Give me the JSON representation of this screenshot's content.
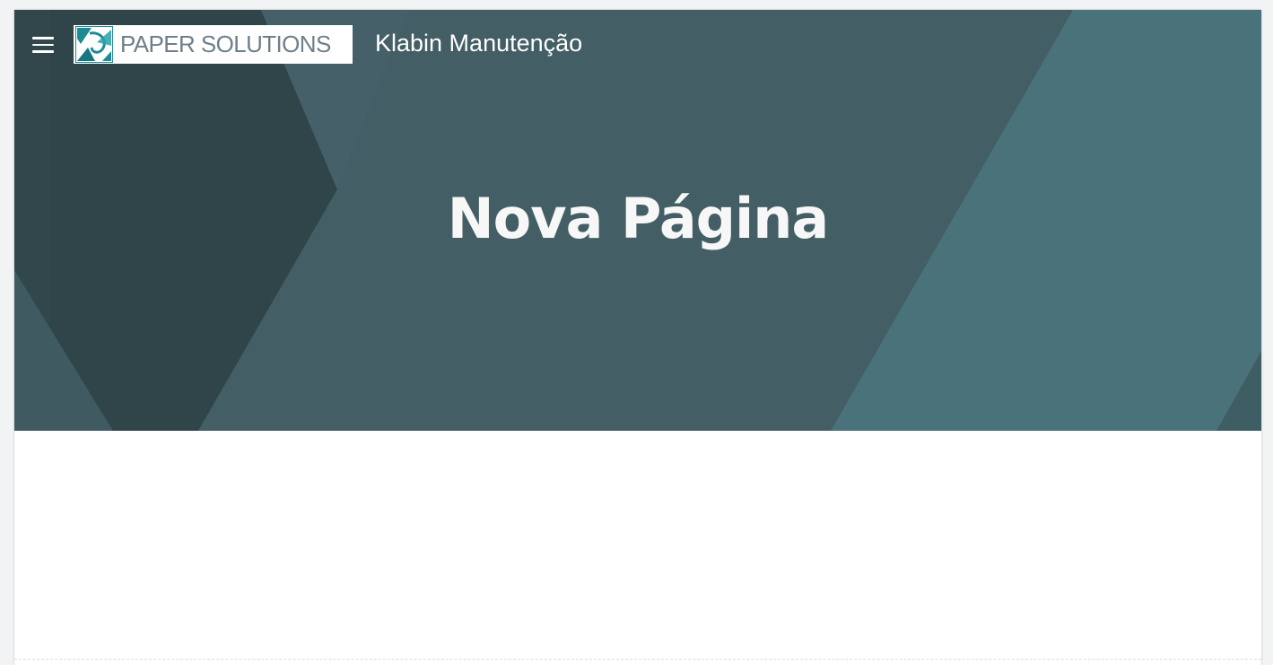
{
  "header": {
    "menu_icon": "hamburger-menu-icon",
    "logo_text": "PAPER SOLUTIONS",
    "site_title": "Klabin Manutenção"
  },
  "hero": {
    "title": "Nova Página"
  },
  "colors": {
    "hero_base": "#3f5a60",
    "hero_dark": "#2f4449",
    "hero_teal": "#4a7077",
    "title_text": "#ffffff",
    "logo_teal": "#1f8a94",
    "logo_text": "#6f7f8a"
  }
}
